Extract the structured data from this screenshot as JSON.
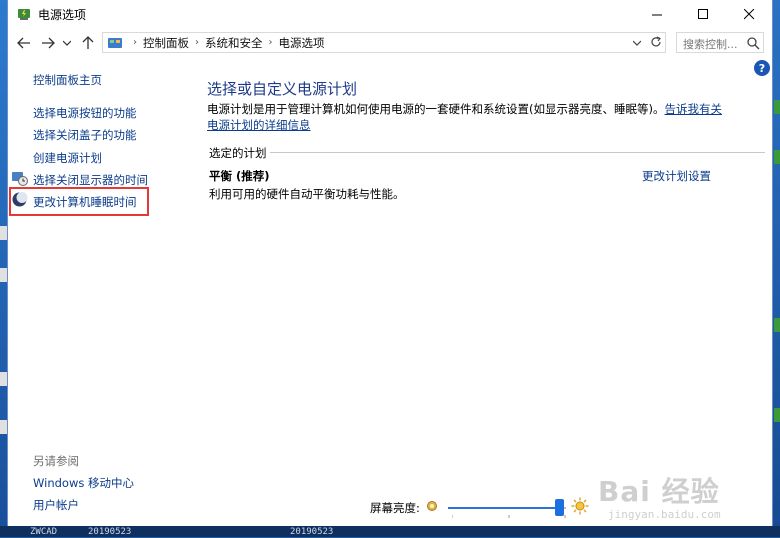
{
  "window": {
    "title": "电源选项",
    "controls": {
      "minimize": "minimize-icon",
      "maximize": "maximize-icon",
      "close": "close-icon"
    }
  },
  "nav": {
    "back_icon": "arrow-left-icon",
    "forward_icon": "arrow-right-icon",
    "recent_icon": "chevron-down-icon",
    "up_icon": "arrow-up-icon",
    "breadcrumbs": [
      "控制面板",
      "系统和安全",
      "电源选项"
    ],
    "search_placeholder": "搜索控制...",
    "search_icon": "search-icon",
    "refresh_icon": "refresh-icon"
  },
  "sidebar": {
    "home": "控制面板主页",
    "links": [
      "选择电源按钮的功能",
      "选择关闭盖子的功能",
      "创建电源计划",
      "选择关闭显示器的时间",
      "更改计算机睡眠时间"
    ],
    "see_also_title": "另请参阅",
    "see_also": [
      "Windows 移动中心",
      "用户帐户"
    ]
  },
  "main": {
    "title": "选择或自定义电源计划",
    "description": "电源计划是用于管理计算机如何使用电源的一套硬件和系统设置(如显示器亮度、睡眠等)。",
    "description_link": "告诉我有关电源计划的详细信息",
    "section_title": "选定的计划",
    "plan": {
      "name": "平衡 (推荐)",
      "description": "利用可用的硬件自动平衡功耗与性能。",
      "change_link": "更改计划设置"
    },
    "help": "?"
  },
  "brightness": {
    "label": "屏幕亮度:",
    "level_percent": 95
  },
  "watermark": {
    "text": "Bai 经验",
    "url": "jingyan.baidu.com"
  },
  "taskbar": {
    "items": [
      "ZWCAD",
      "20190523",
      "20190523"
    ]
  },
  "colors": {
    "link": "#0b3c8c",
    "title": "#1e3a8a",
    "highlight": "#e53935",
    "accent": "#1d6fe0"
  }
}
